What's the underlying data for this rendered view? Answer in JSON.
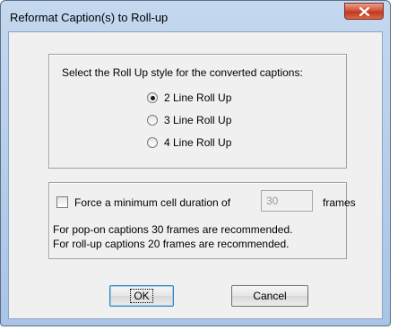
{
  "window": {
    "title": "Reformat Caption(s) to Roll-up",
    "close_icon": "close-icon"
  },
  "rollup_group": {
    "prompt": "Select the Roll Up style for the converted captions:",
    "options": [
      {
        "label": "2 Line Roll Up",
        "selected": true
      },
      {
        "label": "3 Line Roll Up",
        "selected": false
      },
      {
        "label": "4 Line Roll Up",
        "selected": false
      }
    ]
  },
  "duration_group": {
    "checkbox_label": "Force a minimum cell duration of",
    "checked": false,
    "value": "30",
    "unit": "frames",
    "info_lines": [
      "For pop-on captions 30 frames are recommended.",
      "For roll-up captions 20 frames are recommended."
    ]
  },
  "buttons": {
    "ok": "OK",
    "cancel": "Cancel"
  },
  "colors": {
    "titlebar": "#b9d1ea",
    "dialog_bg": "#f0f0f0",
    "close_button": "#c8452a"
  }
}
